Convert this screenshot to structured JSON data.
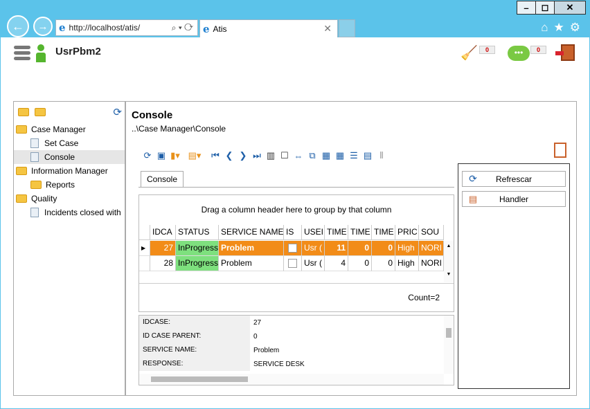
{
  "browser": {
    "address": "http://localhost/atis/",
    "tab_title": "Atis",
    "window_buttons": [
      "–",
      "◻",
      "✕"
    ]
  },
  "header": {
    "username": "UsrPbm2",
    "notifications_count": "0",
    "messages_count": "0"
  },
  "sidebar": {
    "items": [
      {
        "label": "Case Manager",
        "type": "folder",
        "level": 0
      },
      {
        "label": "Set Case",
        "type": "doc",
        "level": 1
      },
      {
        "label": "Console",
        "type": "doc",
        "level": 1
      },
      {
        "label": "Information Manager",
        "type": "folder",
        "level": 0
      },
      {
        "label": "Reports",
        "type": "folder",
        "level": 1
      },
      {
        "label": "Quality",
        "type": "folder",
        "level": 0
      },
      {
        "label": "Incidents closed with",
        "type": "doc",
        "level": 1
      }
    ]
  },
  "main": {
    "title": "Console",
    "breadcrumb": "..\\Case Manager\\Console",
    "tab_label": "Console",
    "group_hint": "Drag a column header here to group by that column",
    "count_label": "Count=2"
  },
  "grid": {
    "columns": [
      "IDCA",
      "STATUS",
      "SERVICE NAME",
      "IS",
      "USEI",
      "TIME",
      "TIME",
      "TIME",
      "PRIC",
      "SOU"
    ],
    "rows": [
      {
        "id": "27",
        "status": "InProgress",
        "service": "Problem",
        "user": "Usr (",
        "t1": "11",
        "t2": "0",
        "t3": "0",
        "priority": "High",
        "source": "NORI"
      },
      {
        "id": "28",
        "status": "InProgress",
        "service": "Problem",
        "user": "Usr (",
        "t1": "4",
        "t2": "0",
        "t3": "0",
        "priority": "High",
        "source": "NORI"
      }
    ]
  },
  "details": [
    {
      "key": "IDCASE:",
      "value": "27"
    },
    {
      "key": "ID CASE PARENT:",
      "value": "0"
    },
    {
      "key": "SERVICE NAME:",
      "value": "Problem"
    },
    {
      "key": "RESPONSE:",
      "value": "SERVICE DESK"
    }
  ],
  "actions": {
    "refresh_label": "Refrescar",
    "handler_label": "Handler"
  }
}
